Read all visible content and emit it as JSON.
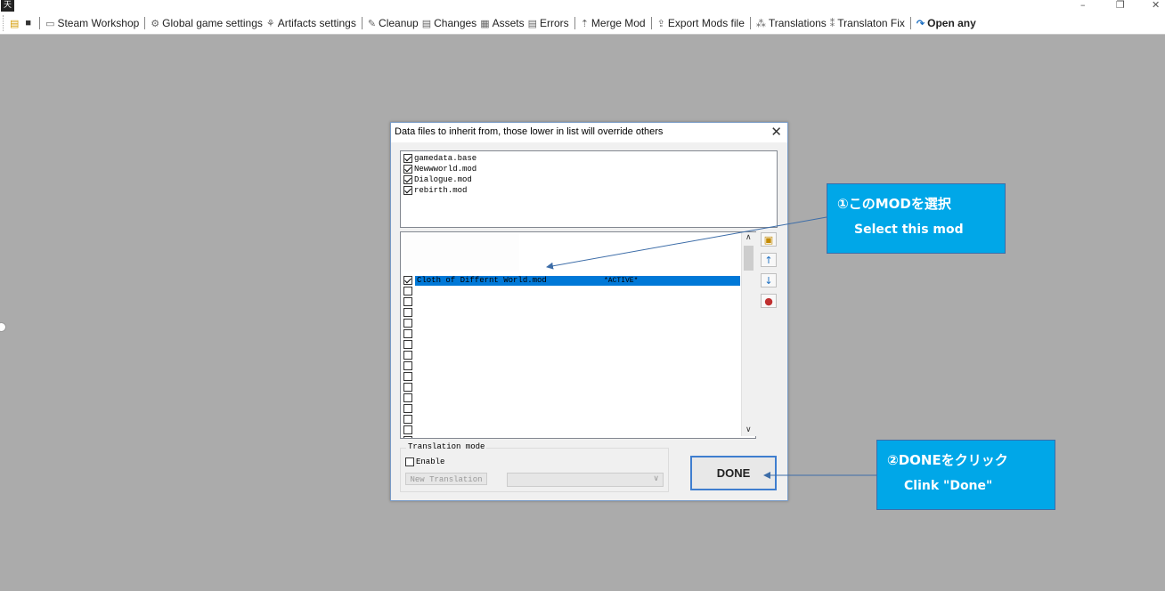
{
  "app": {
    "icon_glyph": "天"
  },
  "window_controls": {
    "minimize": "–",
    "restore": "❐",
    "close": "✕"
  },
  "toolbar": {
    "items": [
      {
        "label": "Steam Workshop",
        "icon": "monitor-icon"
      },
      {
        "label": "Global game settings",
        "icon": "gear-icon"
      },
      {
        "label": "Artifacts settings",
        "icon": "artifact-icon"
      },
      {
        "label": "Cleanup",
        "icon": "broom-icon"
      },
      {
        "label": "Changes",
        "icon": "changes-icon"
      },
      {
        "label": "Assets",
        "icon": "assets-icon"
      },
      {
        "label": "Errors",
        "icon": "errors-icon"
      },
      {
        "label": "Merge Mod",
        "icon": "merge-icon"
      },
      {
        "label": "Export Mods file",
        "icon": "export-icon"
      },
      {
        "label": "Translations",
        "icon": "translate-icon"
      },
      {
        "label": "Translaton Fix",
        "icon": "translate-fix-icon"
      },
      {
        "label": "Open any",
        "icon": "open-icon"
      }
    ]
  },
  "dialog": {
    "title": "Data files to inherit from, those lower in list will override others",
    "base_files": [
      "gamedata.base",
      "Newwworld.mod",
      "Dialogue.mod",
      "rebirth.mod"
    ],
    "selected_mod": "Cloth of Differnt World.mod",
    "active_tag": "*ACTIVE*",
    "translation": {
      "group_label": "Translation mode",
      "enable_label": "Enable",
      "new_button": "New Translation"
    },
    "done_label": "DONE"
  },
  "callouts": {
    "select": {
      "line1": "①このMODを選択",
      "line2": "Select this mod"
    },
    "done": {
      "line1": "②DONEをクリック",
      "line2": "Clink \"Done\""
    }
  },
  "colors": {
    "callout": "#00a7e8",
    "selection": "#0078d7",
    "desktop": "#ababab"
  }
}
